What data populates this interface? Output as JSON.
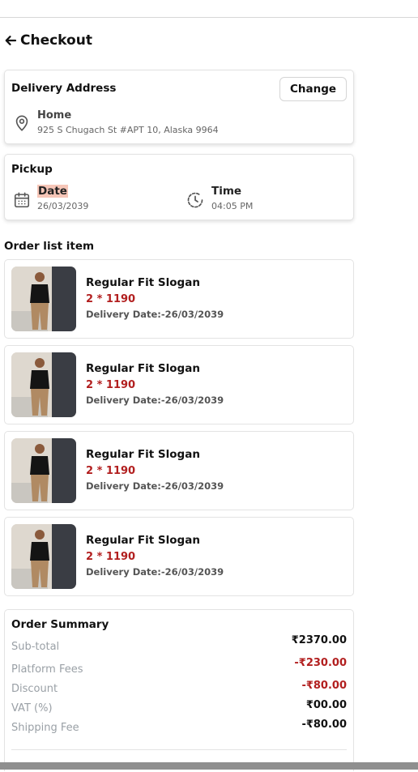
{
  "header": {
    "title": "Checkout",
    "back_icon": "arrow-left-icon"
  },
  "delivery": {
    "title": "Delivery Address",
    "change_label": "Change",
    "location_icon": "map-pin-icon",
    "label": "Home",
    "address": "925 S Chugach St #APT 10, Alaska 9964"
  },
  "pickup": {
    "title": "Pickup",
    "date_label": "Date",
    "date_value": "26/03/2039",
    "time_label": "Time",
    "time_value": "04:05 PM",
    "date_icon": "calendar-icon",
    "time_icon": "clock-icon"
  },
  "order_list": {
    "title": "Order list item",
    "items": [
      {
        "name": "Regular Fit Slogan",
        "qty_price": "2 * 1190",
        "delivery": "Delivery Date:-26/03/2039"
      },
      {
        "name": "Regular Fit Slogan",
        "qty_price": "2 * 1190",
        "delivery": "Delivery Date:-26/03/2039"
      },
      {
        "name": "Regular Fit Slogan",
        "qty_price": "2 * 1190",
        "delivery": "Delivery Date:-26/03/2039"
      },
      {
        "name": "Regular Fit Slogan",
        "qty_price": "2 * 1190",
        "delivery": "Delivery Date:-26/03/2039"
      }
    ]
  },
  "summary": {
    "title": "Order Summary",
    "rows": [
      {
        "label": "Sub-total",
        "value": "₹2370.00",
        "color": "#111111"
      },
      {
        "label": "Platform Fees",
        "value": "-₹230.00",
        "color": "#b21f1f"
      },
      {
        "label": "Discount",
        "value": "-₹80.00",
        "color": "#b21f1f"
      },
      {
        "label": "VAT (%)",
        "value": "₹00.00",
        "color": "#111111"
      },
      {
        "label": "Shipping Fee",
        "value": "-₹80.00",
        "color": "#111111"
      }
    ]
  },
  "colors": {
    "accent_red": "#b21f1f",
    "date_highlight": "#f6c6b8",
    "muted": "#9aa0a6"
  }
}
